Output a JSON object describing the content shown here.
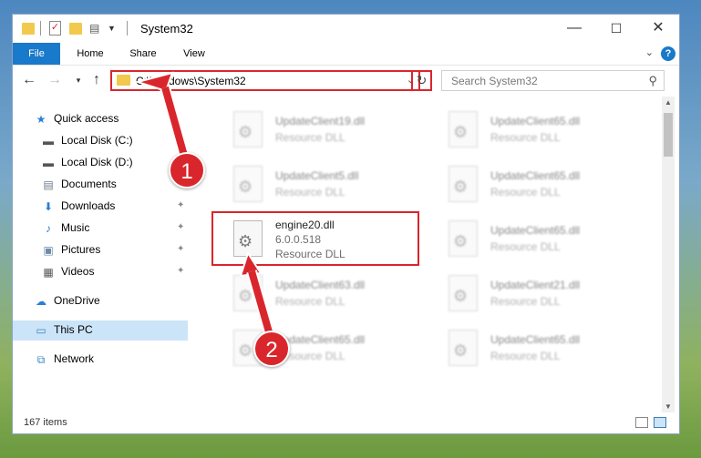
{
  "titlebar": {
    "title": "System32",
    "minimize": "—",
    "maximize": "☐",
    "close": "✕"
  },
  "ribbon": {
    "tabs": [
      "File",
      "Home",
      "Share",
      "View"
    ],
    "help": "?"
  },
  "address": {
    "path": "C:\\Windows\\System32"
  },
  "search": {
    "placeholder": "Search System32"
  },
  "sidebar": {
    "items": [
      {
        "label": "Quick access",
        "icon": "star-icon",
        "pinned": false
      },
      {
        "label": "Local Disk (C:)",
        "icon": "drive-icon",
        "pinned": true
      },
      {
        "label": "Local Disk (D:)",
        "icon": "drive-icon",
        "pinned": true
      },
      {
        "label": "Documents",
        "icon": "documents-icon",
        "pinned": true
      },
      {
        "label": "Downloads",
        "icon": "download-icon",
        "pinned": true
      },
      {
        "label": "Music",
        "icon": "music-icon",
        "pinned": true
      },
      {
        "label": "Pictures",
        "icon": "pictures-icon",
        "pinned": true
      },
      {
        "label": "Videos",
        "icon": "videos-icon",
        "pinned": true
      },
      {
        "label": "OneDrive",
        "icon": "cloud-icon",
        "pinned": false
      },
      {
        "label": "This PC",
        "icon": "computer-icon",
        "pinned": false,
        "selected": true
      },
      {
        "label": "Network",
        "icon": "network-icon",
        "pinned": false
      }
    ]
  },
  "files": [
    {
      "name": "UpdateClient19.dll",
      "type": "Resource DLL"
    },
    {
      "name": "UpdateClient65.dll",
      "type": "Resource DLL"
    },
    {
      "name": "UpdateClient5.dll",
      "type": "Resource DLL"
    },
    {
      "name": "UpdateClient65.dll",
      "type": "Resource DLL"
    },
    {
      "name": "engine20.dll",
      "version": "6.0.0.518",
      "type": "Resource DLL",
      "highlighted": true
    },
    {
      "name": "UpdateClient65.dll",
      "type": "Resource DLL"
    },
    {
      "name": "UpdateClient63.dll",
      "type": "Resource DLL"
    },
    {
      "name": "UpdateClient21.dll",
      "type": "Resource DLL"
    },
    {
      "name": "UpdateClient65.dll",
      "type": "Resource DLL"
    },
    {
      "name": "UpdateClient65.dll",
      "type": "Resource DLL"
    }
  ],
  "status": {
    "item_count": "167 items"
  },
  "callouts": {
    "one": "1",
    "two": "2"
  },
  "colors": {
    "accent": "#1979ca",
    "highlight": "#d9262c"
  }
}
